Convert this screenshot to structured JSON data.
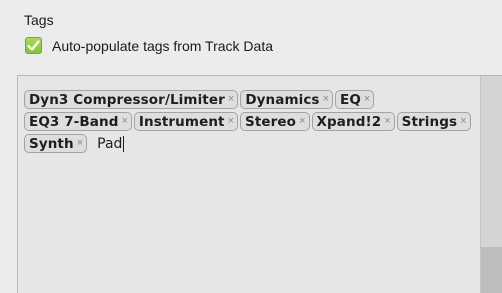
{
  "section": {
    "title": "Tags",
    "auto_populate_label": "Auto-populate tags from Track Data",
    "auto_populate_checked": true,
    "checkbox_color": "#8cc63f"
  },
  "tags": [
    {
      "label": "Dyn3 Compressor/Limiter"
    },
    {
      "label": "Dynamics"
    },
    {
      "label": "EQ"
    },
    {
      "label": "EQ3 7-Band"
    },
    {
      "label": "Instrument"
    },
    {
      "label": "Stereo"
    },
    {
      "label": "Xpand!2"
    },
    {
      "label": "Strings"
    },
    {
      "label": "Synth"
    }
  ],
  "tag_remove_glyph": "×",
  "input": {
    "value": "Pad"
  }
}
